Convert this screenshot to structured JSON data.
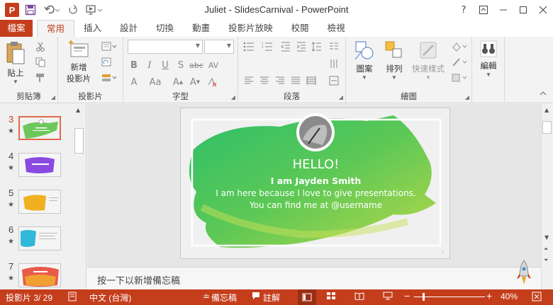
{
  "window": {
    "title": "Juliet - SlidesCarnival - PowerPoint"
  },
  "colors": {
    "accent": "#c43e1c",
    "green": "#5cc46a",
    "lime": "#b8d84a"
  },
  "tabs": [
    "檔案",
    "常用",
    "插入",
    "設計",
    "切換",
    "動畫",
    "投影片放映",
    "校閱",
    "檢視"
  ],
  "ribbon": {
    "clipboard": {
      "label": "剪貼簿",
      "paste": "貼上"
    },
    "slides": {
      "label": "投影片",
      "new_slide_1": "新增",
      "new_slide_2": "投影片"
    },
    "font": {
      "label": "字型"
    },
    "paragraph": {
      "label": "段落"
    },
    "drawing": {
      "label": "繪圖",
      "shapes": "圖案",
      "arrange": "排列",
      "quick_styles": "快速樣式"
    },
    "editing": {
      "label": "編輯"
    }
  },
  "thumbnails": [
    {
      "num": "3",
      "star": "★"
    },
    {
      "num": "4",
      "star": "★"
    },
    {
      "num": "5",
      "star": "★"
    },
    {
      "num": "6",
      "star": "★"
    },
    {
      "num": "7",
      "star": "★"
    }
  ],
  "slide": {
    "heading": "HELLO!",
    "name": "I am Jayden Smith",
    "line1": "I am here because I love to give presentations.",
    "line2": "You can find me at @username",
    "page_number": "3"
  },
  "notes": {
    "placeholder": "按一下以新增備忘稿"
  },
  "status": {
    "slide_info": "投影片 3/ 29",
    "language": "中文 (台灣)",
    "notes": "備忘稿",
    "comments": "註解",
    "zoom": "40%"
  }
}
